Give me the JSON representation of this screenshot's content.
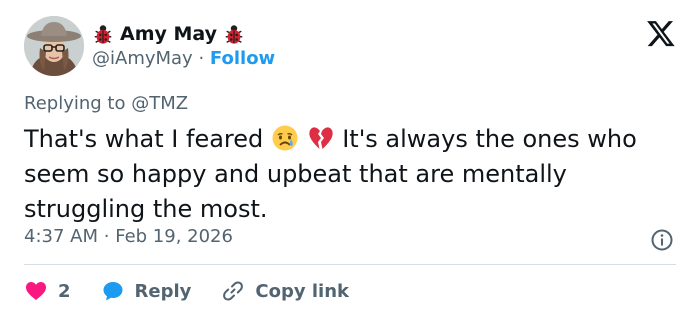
{
  "user": {
    "display_name": "Amy May",
    "handle": "@iAmyMay",
    "separator": "·",
    "follow_label": "Follow"
  },
  "tweet": {
    "reply_prefix": "Replying to",
    "reply_handle": "@TMZ",
    "text_part1": "That's what I feared",
    "text_part2": "It's always the ones who seem so happy and upbeat that are mentally struggling the most.",
    "emojis": [
      "crying-face-icon",
      "broken-heart-icon"
    ],
    "time": "4:37 AM",
    "date": "Feb 19, 2026"
  },
  "actions": {
    "like_count": "2",
    "reply_label": "Reply",
    "copy_link_label": "Copy link"
  },
  "colors": {
    "accent": "#1d9bf0",
    "like": "#f91880",
    "text": "#0f1419",
    "muted": "#536471"
  }
}
